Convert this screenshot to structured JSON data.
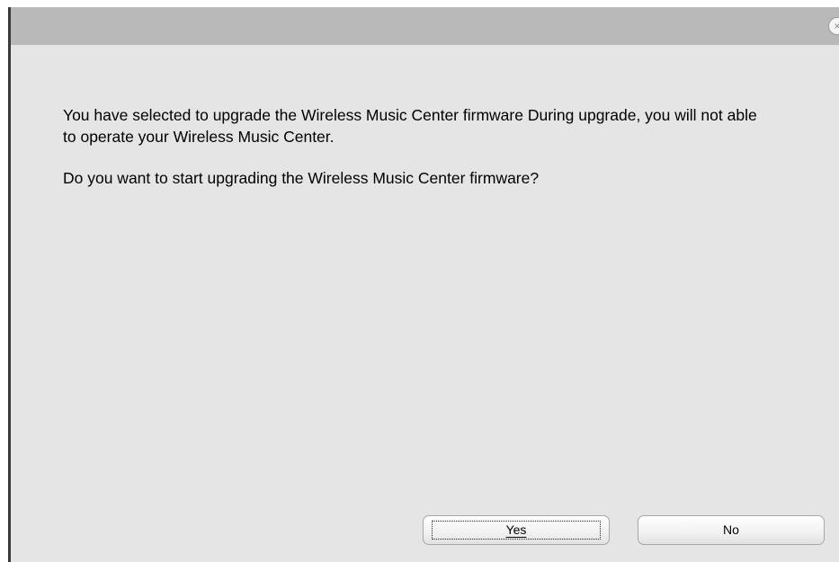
{
  "dialog": {
    "close_symbol": "×",
    "message": {
      "paragraph_1": "You have selected to upgrade the Wireless Music Center firmware During upgrade, you will not able to operate your Wireless Music Center.",
      "paragraph_2": "Do you want to start upgrading the Wireless Music Center firmware?"
    },
    "buttons": {
      "yes_label": "Yes",
      "no_label": "No",
      "focused": "yes"
    }
  },
  "colors": {
    "dialog_background": "#e5e5e5",
    "titlebar_background": "#b9b9b9",
    "text": "#000000"
  },
  "icons": {
    "close": "close-icon"
  }
}
